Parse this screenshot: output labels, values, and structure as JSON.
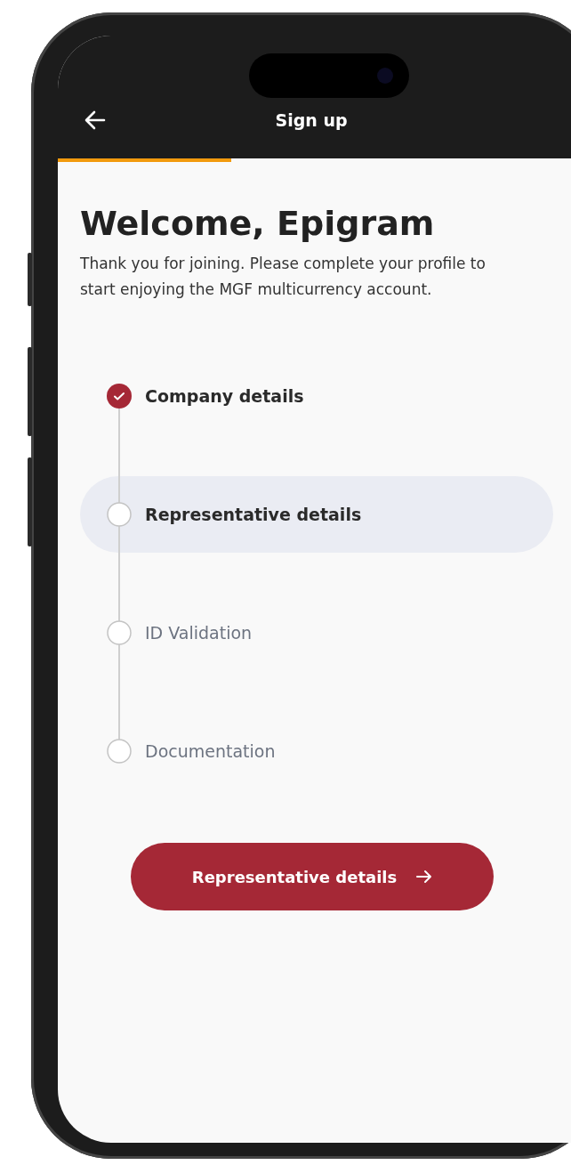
{
  "header": {
    "title": "Sign up",
    "progress": {
      "level": 0.32
    }
  },
  "welcome": {
    "title": "Welcome, Epigram",
    "text": "Thank you for joining. Please complete your profile to start enjoying the MGF multicurrency account."
  },
  "steps": [
    {
      "label": "Company details",
      "done": true,
      "selected": false
    },
    {
      "label": "Representative details",
      "done": false,
      "selected": true
    },
    {
      "label": "ID Validation",
      "done": false,
      "selected": false
    },
    {
      "label": "Documentation",
      "done": false,
      "selected": false
    }
  ],
  "button": {
    "label": "Representative details"
  }
}
